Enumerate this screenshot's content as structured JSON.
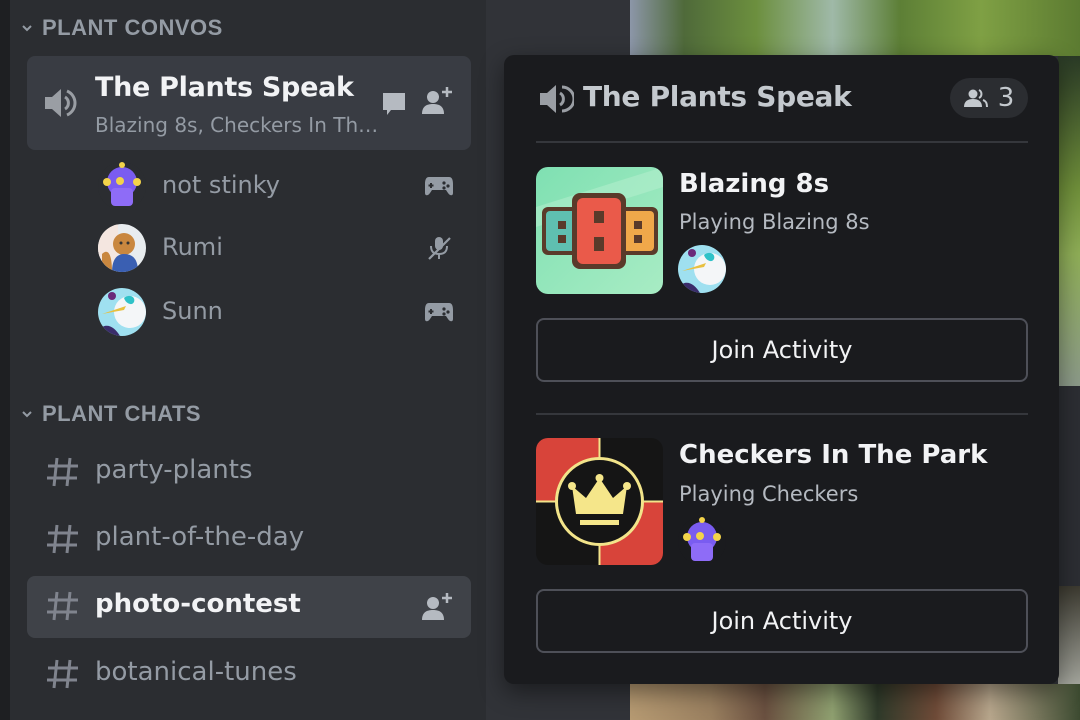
{
  "sidebar": {
    "voice_category": {
      "label": "PLANT CONVOS"
    },
    "voice_channel": {
      "name": "The Plants Speak",
      "activities_summary": "Blazing 8s, Checkers In Th…",
      "icon": "speaker-icon",
      "actions": [
        "chat-icon",
        "invite-user-icon"
      ]
    },
    "voice_users": [
      {
        "name": "not stinky",
        "status_icon": "gamepad-icon"
      },
      {
        "name": "Rumi",
        "status_icon": "mic-muted-icon"
      },
      {
        "name": "Sunn",
        "status_icon": "gamepad-icon"
      }
    ],
    "text_category": {
      "label": "PLANT CHATS"
    },
    "text_channels": [
      {
        "name": "party-plants",
        "selected": false
      },
      {
        "name": "plant-of-the-day",
        "selected": false
      },
      {
        "name": "photo-contest",
        "selected": true
      },
      {
        "name": "botanical-tunes",
        "selected": false
      }
    ]
  },
  "popup": {
    "title": "The Plants Speak",
    "member_count": "3",
    "activities": [
      {
        "name": "Blazing 8s",
        "status": "Playing Blazing 8s",
        "participant": "Sunn",
        "join_label": "Join Activity"
      },
      {
        "name": "Checkers In The Park",
        "status": "Playing Checkers",
        "participant": "not stinky",
        "join_label": "Join Activity"
      }
    ]
  },
  "colors": {
    "sidebar_bg": "#2b2d31",
    "selected_bg": "#3f4248",
    "popup_bg": "#1a1b1e",
    "muted_text": "#949ba4",
    "bright_text": "#f2f3f5"
  }
}
